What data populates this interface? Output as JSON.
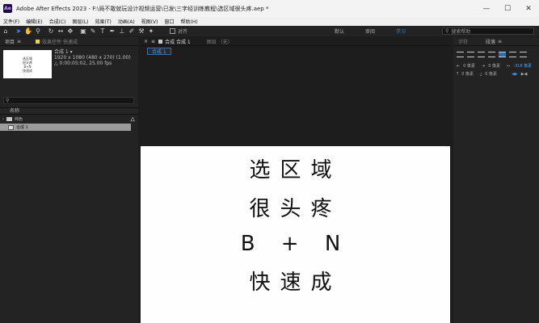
{
  "window": {
    "app_icon": "Ae",
    "title": "Adobe After Effects 2023 - F:\\局不敢就玩设计视频运营\\已发\\三字经训练教程\\选区域很头疼.aep *",
    "controls": [
      "—",
      "☐",
      "✕"
    ]
  },
  "menu": [
    "文件(F)",
    "编辑(E)",
    "合成(C)",
    "图层(L)",
    "效果(T)",
    "动画(A)",
    "视图(V)",
    "窗口",
    "帮助(H)"
  ],
  "toolbar": {
    "tools": [
      "⌂",
      "➤",
      "✋",
      "⚲",
      "↻",
      "↔",
      "✥",
      "▣",
      "✎",
      "T",
      "✒",
      "⊥",
      "✐",
      "⚒",
      "✦"
    ],
    "align_label": "对齐",
    "workspaces": [
      "默认",
      "审阅",
      "学习"
    ],
    "active_workspace": "学习",
    "search_placeholder": "搜索帮助"
  },
  "project_panel": {
    "tab_project": "项目",
    "tab_effects": "效果控件 快速成",
    "comp_name": "合成 1 ▾",
    "comp_info_1": "1920 x 1080 (480 x 270) (1.00)",
    "comp_info_2": "△ 0:00:05:02, 25.00 fps",
    "thumb_lines": [
      "选区域",
      "很头疼",
      "B+N",
      "快速成"
    ],
    "search_placeholder": "⚲",
    "column_name": "名称",
    "items": [
      {
        "name": "纯色",
        "type": "folder"
      },
      {
        "name": "合成 1",
        "type": "comp",
        "selected": true
      }
    ]
  },
  "composition_panel": {
    "tab_comp": "合成 合成 1",
    "tab_layer": "图层 （无）",
    "sub_tab": "合成 1",
    "lines": [
      "选区域",
      "很头疼",
      "B + N",
      "快速成"
    ]
  },
  "right_panel": {
    "tab_char": "字符",
    "tab_para": "段落",
    "indent_left": "0 像素",
    "indent_right": "0 像素",
    "indent_first": "-316 像素",
    "space_before": "0 像素",
    "space_after": "0 像素"
  },
  "colors": {
    "accent": "#2d8ceb",
    "effects_square": "#e8d44d",
    "project_square": "#c9c9c9"
  }
}
